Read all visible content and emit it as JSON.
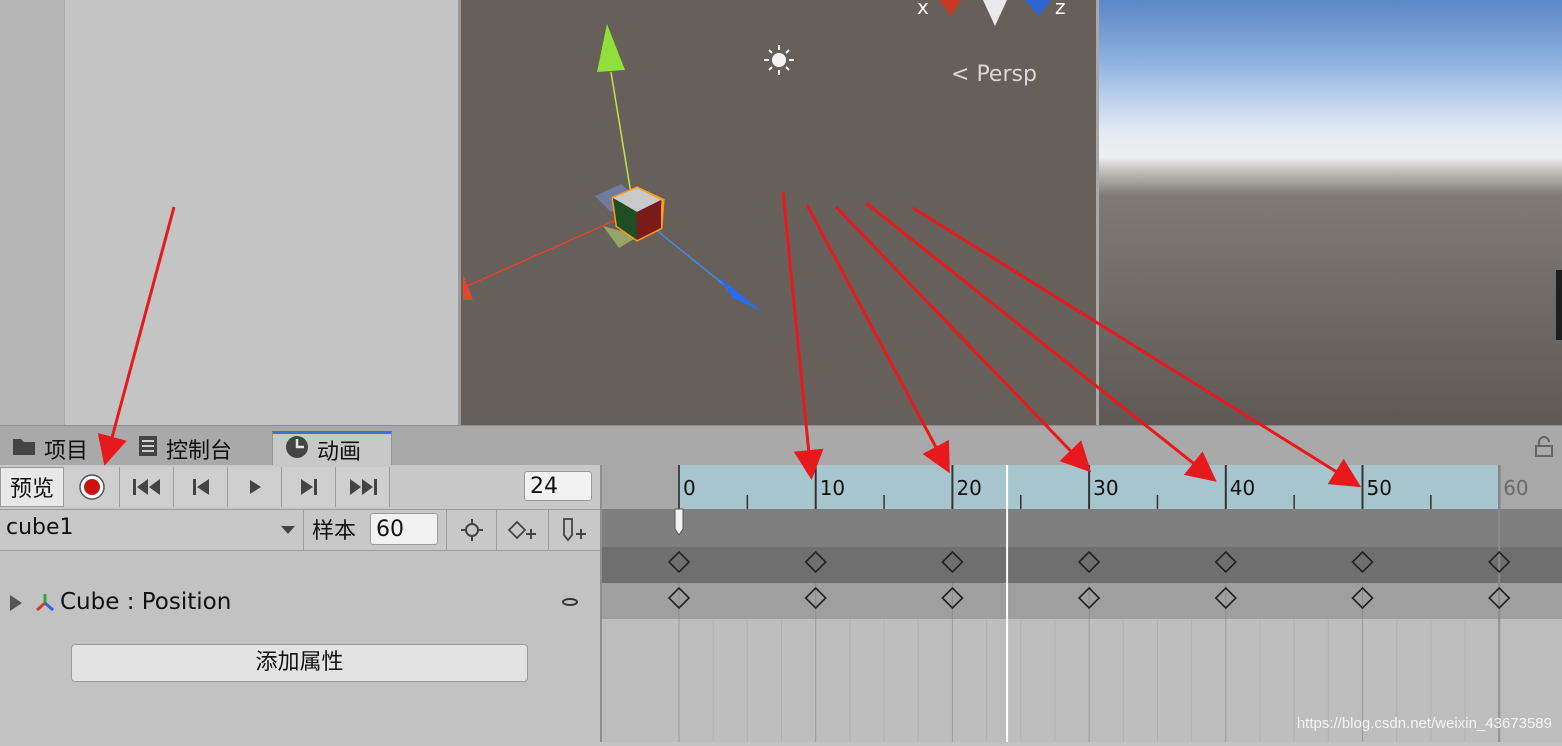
{
  "scene": {
    "persp_label": "Persp",
    "axis_x": "x",
    "axis_z": "z"
  },
  "tabs": [
    {
      "label": "项目",
      "icon": "folder-icon"
    },
    {
      "label": "控制台",
      "icon": "console-icon"
    },
    {
      "label": "动画",
      "icon": "clock-icon",
      "active": true
    }
  ],
  "toolbar": {
    "preview_label": "预览",
    "record_icon": "record-icon",
    "current_frame": "24"
  },
  "clip": {
    "name": "cube1",
    "samples_label": "样本",
    "samples_value": "60"
  },
  "property": {
    "label": "Cube : Position"
  },
  "add_property_label": "添加属性",
  "timeline": {
    "ruler_labels": [
      "0",
      "10",
      "20",
      "30",
      "40",
      "50",
      "60"
    ],
    "keyframes": [
      0,
      10,
      20,
      30,
      40,
      50,
      60
    ],
    "playhead_frame": 24
  },
  "watermark": "https://blog.csdn.net/weixin_43673589",
  "colors": {
    "ruler": "#a6c5cc",
    "annotation": "#e8191c",
    "tab_accent": "#3a72d6"
  }
}
